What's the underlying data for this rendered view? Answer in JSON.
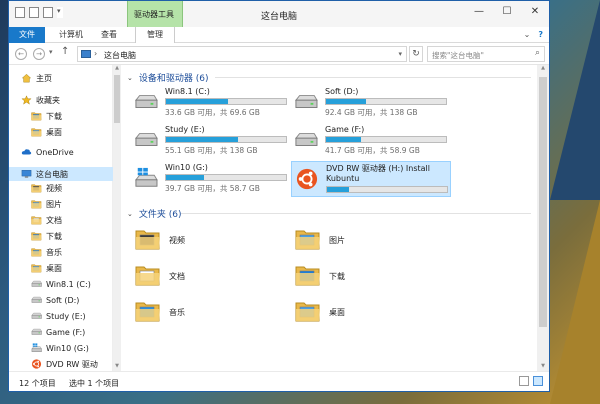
{
  "window": {
    "title": "这台电脑",
    "context_tab_label": "驱动器工具"
  },
  "ribbon": {
    "tabs": [
      "文件",
      "计算机",
      "查看",
      "管理"
    ]
  },
  "address": {
    "path": "这台电脑",
    "search_placeholder": "搜索\"这台电脑\""
  },
  "sidebar": {
    "items": [
      {
        "label": "主页",
        "icon": "home-icon"
      },
      {
        "label": "收藏夹",
        "icon": "star-icon"
      },
      {
        "label": "下载",
        "icon": "downloads-folder-icon"
      },
      {
        "label": "桌面",
        "icon": "desktop-folder-icon"
      },
      {
        "label": "OneDrive",
        "icon": "cloud-icon"
      },
      {
        "label": "这台电脑",
        "icon": "computer-icon"
      },
      {
        "label": "视频",
        "icon": "videos-folder-icon"
      },
      {
        "label": "图片",
        "icon": "pictures-folder-icon"
      },
      {
        "label": "文档",
        "icon": "documents-folder-icon"
      },
      {
        "label": "下载",
        "icon": "downloads-folder-icon"
      },
      {
        "label": "音乐",
        "icon": "music-folder-icon"
      },
      {
        "label": "桌面",
        "icon": "desktop-folder-icon"
      },
      {
        "label": "Win8.1 (C:)",
        "icon": "drive-icon"
      },
      {
        "label": "Soft (D:)",
        "icon": "drive-icon"
      },
      {
        "label": "Study (E:)",
        "icon": "drive-icon"
      },
      {
        "label": "Game (F:)",
        "icon": "drive-icon"
      },
      {
        "label": "Win10 (G:)",
        "icon": "windows-drive-icon"
      },
      {
        "label": "DVD RW 驱动",
        "icon": "ubuntu-dvd-icon"
      }
    ]
  },
  "devices": {
    "header": "设备和驱动器 (6)",
    "items": [
      {
        "name": "Win8.1 (C:)",
        "free": "33.6 GB 可用，共 69.6 GB",
        "used_fraction": 0.52,
        "icon": "hard-drive-icon"
      },
      {
        "name": "Soft (D:)",
        "free": "92.4 GB 可用，共 138 GB",
        "used_fraction": 0.33,
        "icon": "hard-drive-icon"
      },
      {
        "name": "Study (E:)",
        "free": "55.1 GB 可用，共 138 GB",
        "used_fraction": 0.6,
        "icon": "hard-drive-icon"
      },
      {
        "name": "Game (F:)",
        "free": "41.7 GB 可用，共 58.9 GB",
        "used_fraction": 0.29,
        "icon": "hard-drive-icon"
      },
      {
        "name": "Win10 (G:)",
        "free": "39.7 GB 可用，共 58.7 GB",
        "used_fraction": 0.32,
        "icon": "windows-drive-icon"
      },
      {
        "name": "DVD RW 驱动器 (H:) Install Kubuntu",
        "free": "",
        "used_fraction": 0.18,
        "icon": "ubuntu-dvd-icon"
      }
    ]
  },
  "folders": {
    "header": "文件夹 (6)",
    "items": [
      {
        "name": "视频",
        "icon": "videos-folder-icon"
      },
      {
        "name": "图片",
        "icon": "pictures-folder-icon"
      },
      {
        "name": "文档",
        "icon": "documents-folder-icon"
      },
      {
        "name": "下载",
        "icon": "downloads-folder-icon"
      },
      {
        "name": "音乐",
        "icon": "music-folder-icon"
      },
      {
        "name": "桌面",
        "icon": "desktop-folder-icon"
      }
    ]
  },
  "status": {
    "count": "12 个项目",
    "selected": "选中 1 个项目"
  },
  "colors": {
    "accent": "#1979ca",
    "bar_fill": "#26a0da",
    "selection": "#cce8ff",
    "context_tab": "#b5e3a8",
    "group_header": "#1e4e9a"
  }
}
